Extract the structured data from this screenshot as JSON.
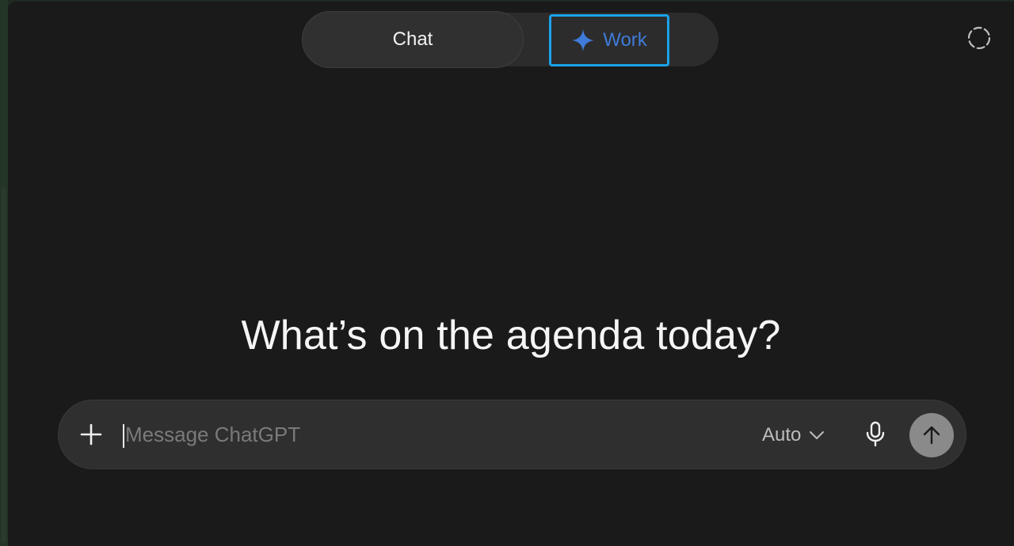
{
  "header": {
    "modes": [
      {
        "label": "Chat",
        "selected": false
      },
      {
        "label": "Work",
        "selected": true
      }
    ],
    "temporary_chat_icon": "dashed-circle-icon"
  },
  "main": {
    "headline": "What’s on the agenda today?"
  },
  "composer": {
    "placeholder": "Message ChatGPT",
    "value": "",
    "model_label": "Auto",
    "icons": {
      "attach": "plus-icon",
      "model_dropdown": "chevron-down-icon",
      "voice": "microphone-icon",
      "send": "arrow-up-icon"
    }
  },
  "colors": {
    "background": "#1a1a1a",
    "work_accent": "#3f7bd8",
    "focus_ring": "#19a3e8",
    "send_button": "#8a8a8a"
  }
}
